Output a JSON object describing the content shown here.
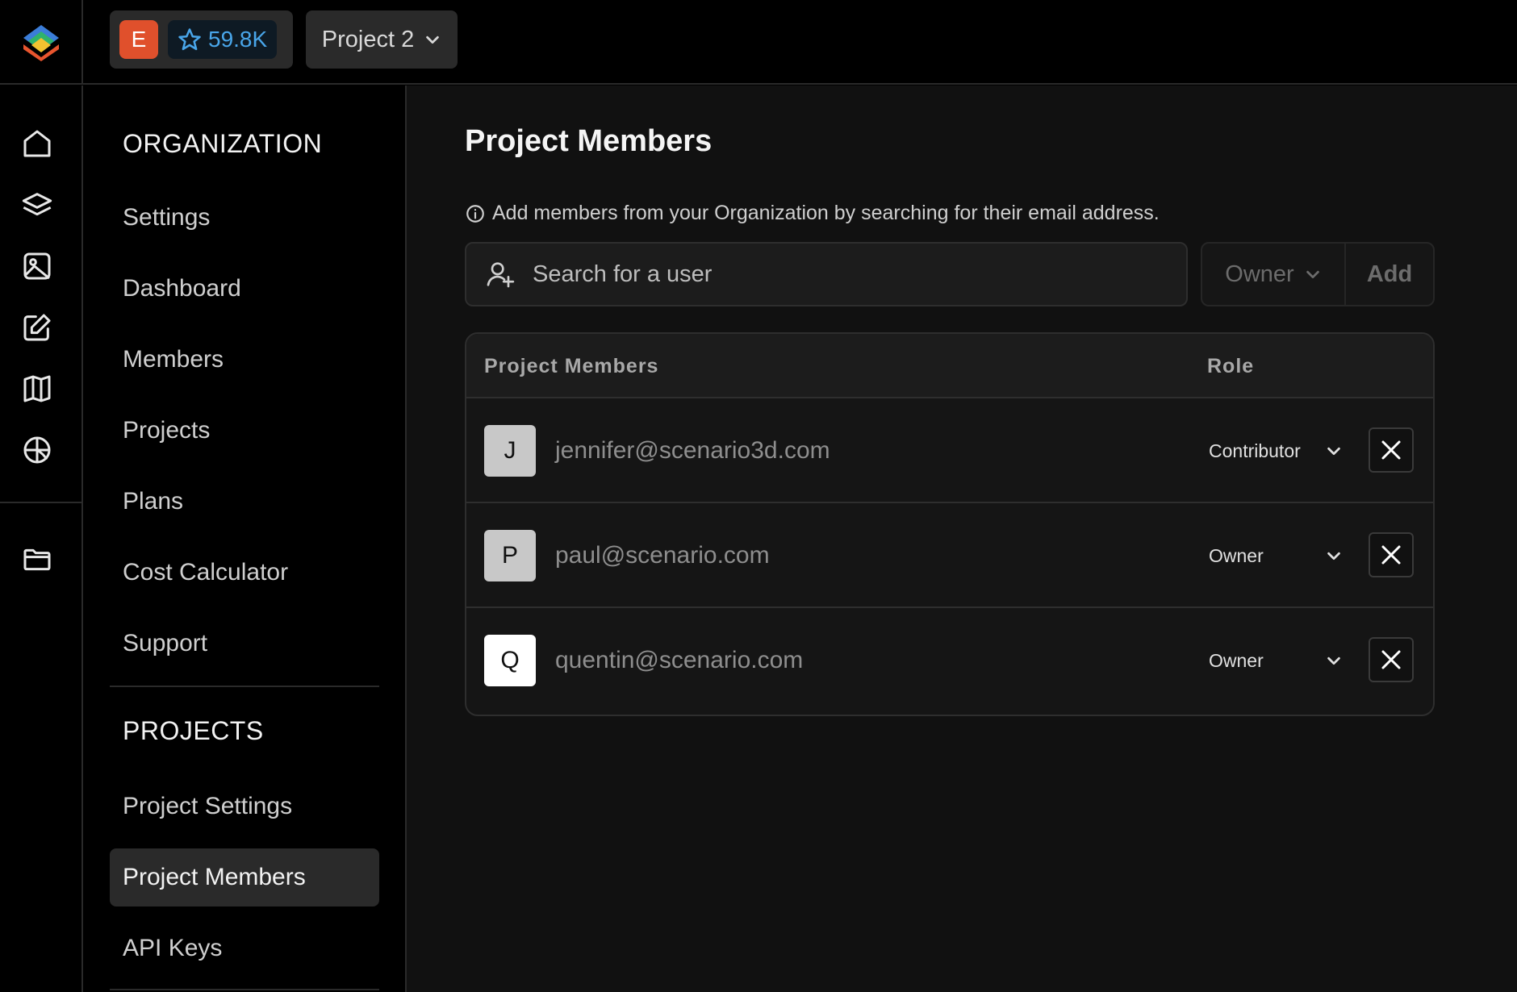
{
  "topbar": {
    "org_initial": "E",
    "stars": "59.8K",
    "project_name": "Project 2"
  },
  "rail": {
    "icons": [
      "home-icon",
      "layers-icon",
      "image-icon",
      "edit-icon",
      "canvas-icon",
      "globe-icon",
      "folder-icon"
    ]
  },
  "sidebar": {
    "organization_title": "ORGANIZATION",
    "organization_items": [
      {
        "label": "Settings"
      },
      {
        "label": "Dashboard"
      },
      {
        "label": "Members"
      },
      {
        "label": "Projects"
      },
      {
        "label": "Plans"
      },
      {
        "label": "Cost Calculator"
      },
      {
        "label": "Support"
      }
    ],
    "projects_title": "PROJECTS",
    "project_items": [
      {
        "label": "Project Settings"
      },
      {
        "label": "Project Members",
        "active": true
      },
      {
        "label": "API Keys"
      }
    ]
  },
  "main": {
    "title": "Project Members",
    "info": "Add members from your Organization by searching for their email address.",
    "search_placeholder": "Search for a user",
    "role_selected": "Owner",
    "add_label": "Add",
    "table": {
      "col_members": "Project Members",
      "col_role": "Role",
      "rows": [
        {
          "initial": "J",
          "email": "jennifer@scenario3d.com",
          "role": "Contributor",
          "avatar_color": "#c8c8c8"
        },
        {
          "initial": "P",
          "email": "paul@scenario.com",
          "role": "Owner",
          "avatar_color": "#c8c8c8"
        },
        {
          "initial": "Q",
          "email": "quentin@scenario.com",
          "role": "Owner",
          "avatar_color": "#ffffff"
        }
      ]
    }
  },
  "colors": {
    "org_avatar": "#e0502c",
    "star_text": "#49a6ea",
    "background": "#111111"
  }
}
